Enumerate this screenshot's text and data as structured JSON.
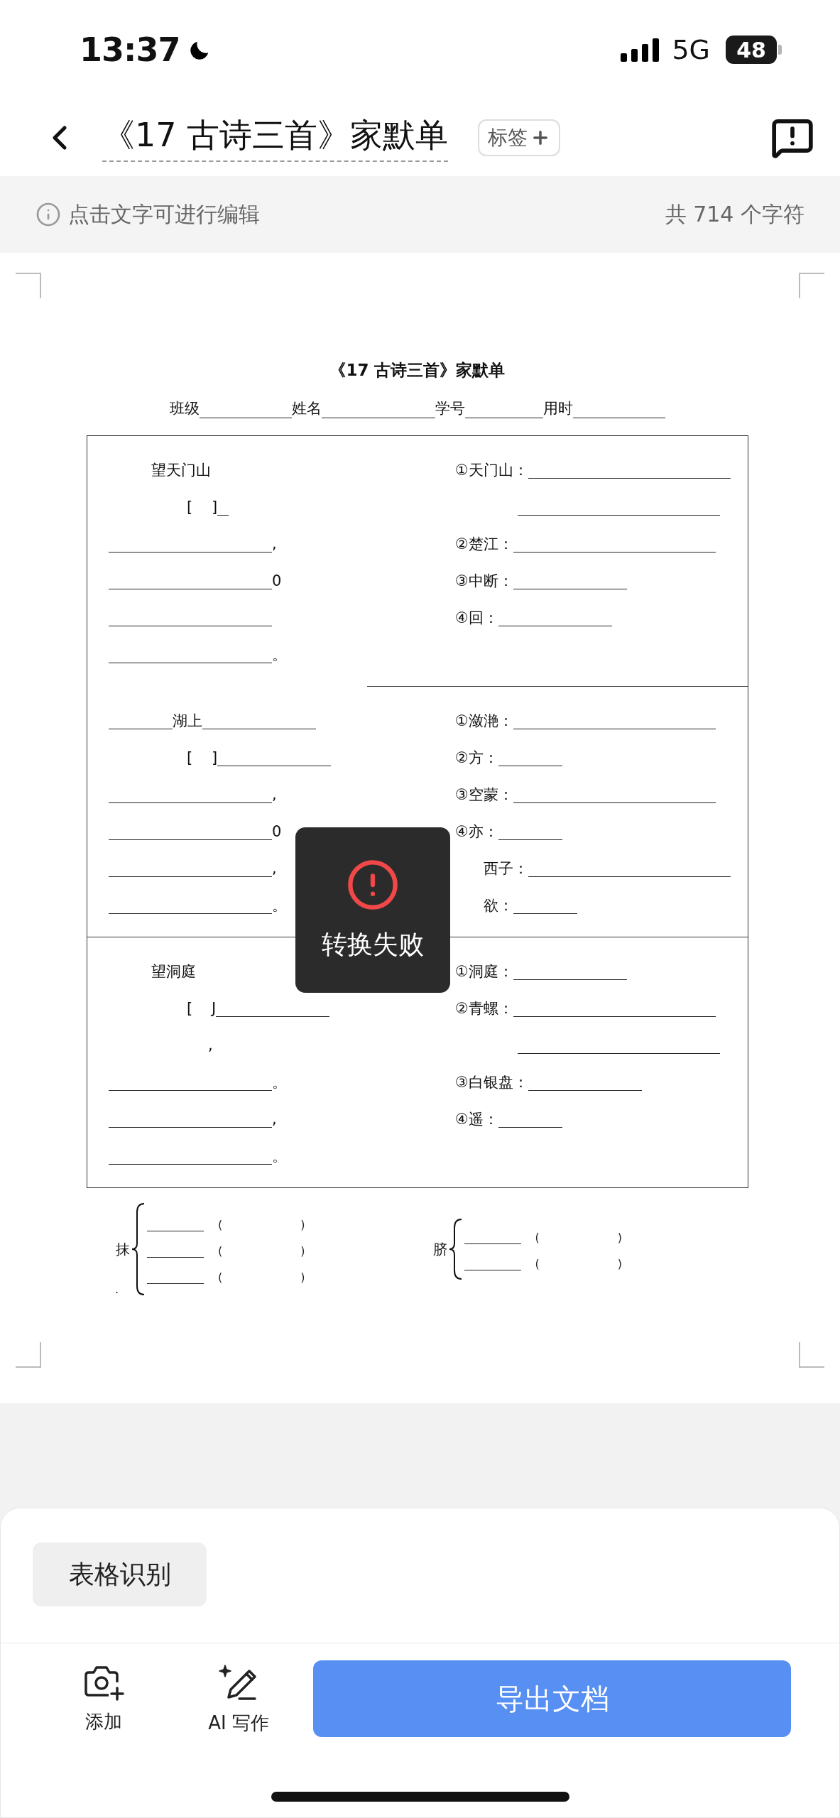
{
  "status_bar": {
    "time": "13:37",
    "network": "5G",
    "battery": "48"
  },
  "header": {
    "title": "《17 古诗三首》家默单",
    "tag_button": "标签"
  },
  "info_bar": {
    "hint": "点击文字可进行编辑",
    "count": "共 714 个字符"
  },
  "document": {
    "title": "《17 古诗三首》家默单",
    "fields": [
      "班级",
      "姓名",
      "学号",
      "用时"
    ],
    "sections": [
      {
        "left": [
          {
            "kind": "heading",
            "parts": [
              {
                "kind": "text",
                "text": "望天门山"
              }
            ]
          },
          {
            "kind": "author",
            "parts": [
              {
                "kind": "text",
                "text": "[    ]"
              },
              {
                "kind": "tiny_blank"
              }
            ]
          },
          {
            "kind": "verse",
            "parts": [
              {
                "kind": "long_blank"
              },
              {
                "kind": "text",
                "text": ","
              }
            ]
          },
          {
            "kind": "verse",
            "parts": [
              {
                "kind": "long_blank"
              },
              {
                "kind": "text",
                "text": "0"
              }
            ]
          },
          {
            "kind": "verse",
            "parts": [
              {
                "kind": "long_blank"
              }
            ]
          },
          {
            "kind": "verse",
            "parts": [
              {
                "kind": "long_blank"
              },
              {
                "kind": "text",
                "text": "。"
              }
            ]
          }
        ],
        "right": [
          {
            "kind": "item",
            "parts": [
              {
                "kind": "text",
                "text": "①天门山："
              },
              {
                "kind": "xlong_blank"
              }
            ]
          },
          {
            "kind": "continuation",
            "parts": [
              {
                "kind": "xlong_blank"
              }
            ]
          },
          {
            "kind": "item",
            "parts": [
              {
                "kind": "text",
                "text": "②楚江："
              },
              {
                "kind": "xlong_blank"
              }
            ]
          },
          {
            "kind": "item",
            "parts": [
              {
                "kind": "text",
                "text": "③中断："
              },
              {
                "kind": "medium_blank"
              }
            ]
          },
          {
            "kind": "item",
            "parts": [
              {
                "kind": "text",
                "text": "④回："
              },
              {
                "kind": "medium_blank"
              }
            ]
          }
        ]
      },
      {
        "left": [
          {
            "kind": "verse",
            "parts": [
              {
                "kind": "short_blank"
              },
              {
                "kind": "text",
                "text": "湖上"
              },
              {
                "kind": "medium_blank"
              }
            ]
          },
          {
            "kind": "author",
            "parts": [
              {
                "kind": "text",
                "text": "[    ]"
              },
              {
                "kind": "medium_blank"
              }
            ]
          },
          {
            "kind": "verse",
            "parts": [
              {
                "kind": "long_blank"
              },
              {
                "kind": "text",
                "text": ","
              }
            ]
          },
          {
            "kind": "verse",
            "parts": [
              {
                "kind": "long_blank"
              },
              {
                "kind": "text",
                "text": "0"
              }
            ]
          },
          {
            "kind": "verse",
            "parts": [
              {
                "kind": "long_blank"
              },
              {
                "kind": "text",
                "text": ","
              }
            ]
          },
          {
            "kind": "verse",
            "parts": [
              {
                "kind": "long_blank"
              },
              {
                "kind": "text",
                "text": "。"
              }
            ]
          }
        ],
        "right": [
          {
            "kind": "item",
            "parts": [
              {
                "kind": "text",
                "text": "①潋滟："
              },
              {
                "kind": "xlong_blank"
              }
            ]
          },
          {
            "kind": "item",
            "parts": [
              {
                "kind": "text",
                "text": "②方："
              },
              {
                "kind": "short_blank"
              }
            ]
          },
          {
            "kind": "item",
            "parts": [
              {
                "kind": "text",
                "text": "③空蒙："
              },
              {
                "kind": "xlong_blank"
              }
            ]
          },
          {
            "kind": "item",
            "parts": [
              {
                "kind": "text",
                "text": "④亦："
              },
              {
                "kind": "short_blank"
              }
            ]
          },
          {
            "kind": "hidden_number",
            "parts": [
              {
                "kind": "text",
                "text": "西子："
              },
              {
                "kind": "xlong_blank"
              }
            ]
          },
          {
            "kind": "hidden_number",
            "parts": [
              {
                "kind": "text",
                "text": "欲："
              },
              {
                "kind": "short_blank"
              }
            ]
          }
        ]
      },
      {
        "left": [
          {
            "kind": "heading",
            "parts": [
              {
                "kind": "text",
                "text": "望洞庭"
              }
            ]
          },
          {
            "kind": "author",
            "parts": [
              {
                "kind": "text",
                "text": "[    J"
              },
              {
                "kind": "medium_blank"
              }
            ]
          },
          {
            "kind": "pause",
            "parts": [
              {
                "kind": "text",
                "text": ","
              }
            ]
          },
          {
            "kind": "verse",
            "parts": [
              {
                "kind": "long_blank"
              },
              {
                "kind": "text",
                "text": "。"
              }
            ]
          },
          {
            "kind": "verse",
            "parts": [
              {
                "kind": "long_blank"
              },
              {
                "kind": "text",
                "text": ","
              }
            ]
          },
          {
            "kind": "verse",
            "parts": [
              {
                "kind": "long_blank"
              },
              {
                "kind": "text",
                "text": "。"
              }
            ]
          }
        ],
        "right": [
          {
            "kind": "item",
            "parts": [
              {
                "kind": "text",
                "text": "①洞庭："
              },
              {
                "kind": "medium_blank"
              }
            ]
          },
          {
            "kind": "item",
            "parts": [
              {
                "kind": "text",
                "text": "②青螺："
              },
              {
                "kind": "xlong_blank"
              }
            ]
          },
          {
            "kind": "continuation",
            "parts": [
              {
                "kind": "xlong_blank"
              }
            ]
          },
          {
            "kind": "item",
            "parts": [
              {
                "kind": "text",
                "text": "③白银盘："
              },
              {
                "kind": "medium_blank"
              }
            ]
          },
          {
            "kind": "item",
            "parts": [
              {
                "kind": "text",
                "text": "④遥："
              },
              {
                "kind": "short_blank"
              }
            ]
          }
        ]
      }
    ],
    "word_groups": [
      {
        "head": "抹",
        "mark": ".",
        "rows": [
          {
            "open": "(",
            "close": ")"
          },
          {
            "open": "(",
            "close": ")"
          },
          {
            "open": "(",
            "close": ")"
          }
        ]
      },
      {
        "head": "脐",
        "rows": [
          {
            "open": "(",
            "close": ")"
          },
          {
            "open": "(",
            "close": ")"
          }
        ]
      }
    ]
  },
  "toast": {
    "message": "转换失败"
  },
  "bottom_sheet": {
    "chip": "表格识别",
    "tools": [
      {
        "kind": "camera",
        "label": "添加"
      },
      {
        "kind": "ai_pen",
        "label": "AI 写作"
      }
    ],
    "export_button": "导出文档"
  }
}
